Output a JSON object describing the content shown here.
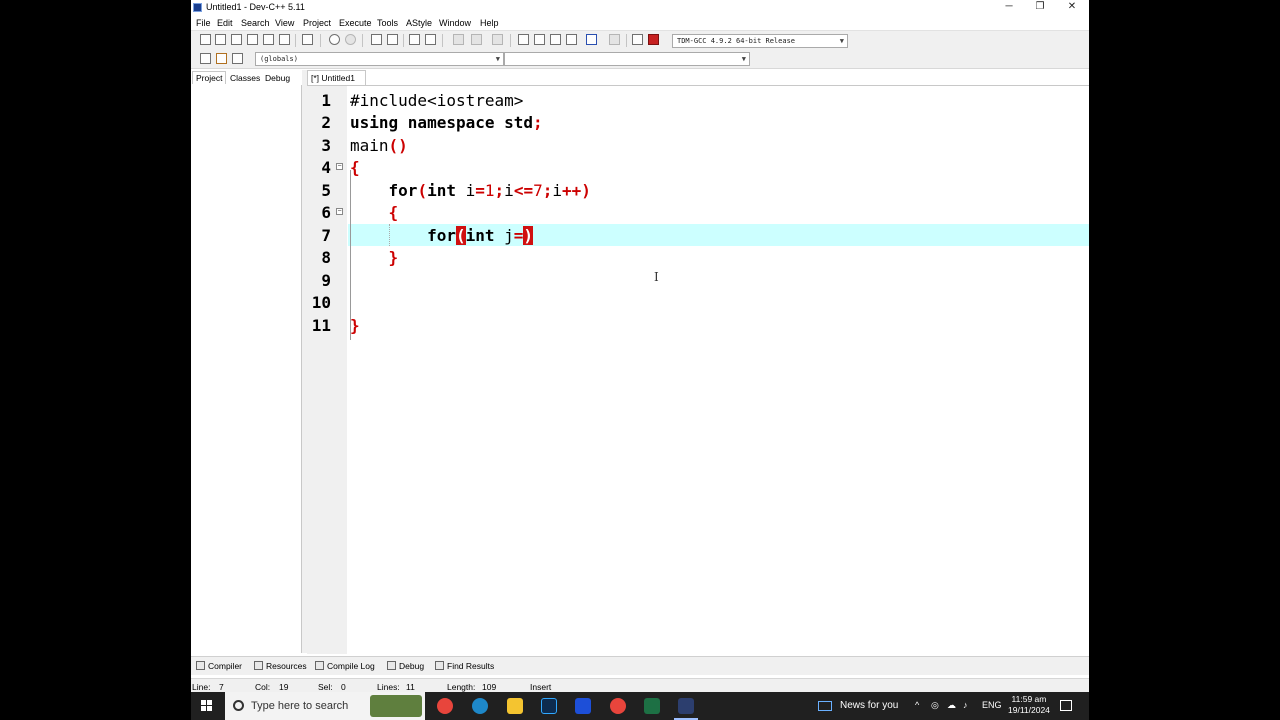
{
  "window": {
    "title": "Untitled1 - Dev-C++ 5.11",
    "min_glyph": "─",
    "max_glyph": "❐",
    "close_glyph": "✕"
  },
  "menu": [
    "File",
    "Edit",
    "Search",
    "View",
    "Project",
    "Execute",
    "Tools",
    "AStyle",
    "Window",
    "Help"
  ],
  "toolbar": {
    "compiler_select": "TDM-GCC 4.9.2 64-bit Release",
    "scope_select": "(globals)",
    "member_select": ""
  },
  "left_tabs": [
    "Project",
    "Classes",
    "Debug"
  ],
  "editor_tab": "[*] Untitled1",
  "code": {
    "line_numbers": [
      "1",
      "2",
      "3",
      "4",
      "5",
      "6",
      "7",
      "8",
      "9",
      "10",
      "11"
    ],
    "lines": [
      "#include<iostream>",
      "using namespace std;",
      "main()",
      "{",
      "    for(int i=1;i<=7;i++)",
      "    {",
      "        for(int j=)",
      "    }",
      "",
      "",
      "}"
    ],
    "current_line": 7
  },
  "bottom_tabs": [
    "Compiler",
    "Resources",
    "Compile Log",
    "Debug",
    "Find Results"
  ],
  "status": {
    "line_label": "Line:",
    "line_value": "7",
    "col_label": "Col:",
    "col_value": "19",
    "sel_label": "Sel:",
    "sel_value": "0",
    "lines_label": "Lines:",
    "lines_value": "11",
    "length_label": "Length:",
    "length_value": "109",
    "mode": "Insert"
  },
  "taskbar": {
    "search_placeholder": "Type here to search",
    "news": "News for you",
    "language": "ENG",
    "time": "11:59 am",
    "date": "19/11/2024",
    "apps": [
      "chrome-icon",
      "edge-icon",
      "file-explorer-icon",
      "photoshop-icon",
      "b-app-icon",
      "chrome-profile-icon",
      "excel-icon",
      "devcpp-icon"
    ],
    "colors": {
      "chrome": "#e8453c",
      "edge": "#1e88c9",
      "explorer": "#f4c430",
      "photoshop": "#0d2b4e",
      "b_app": "#1d4fd8",
      "excel": "#1d7044",
      "devcpp": "#2c3e6e"
    }
  },
  "colors": {
    "current_line_highlight": "#ccffff",
    "symbol_red": "#cc0000",
    "brace_match": "#d01010"
  }
}
